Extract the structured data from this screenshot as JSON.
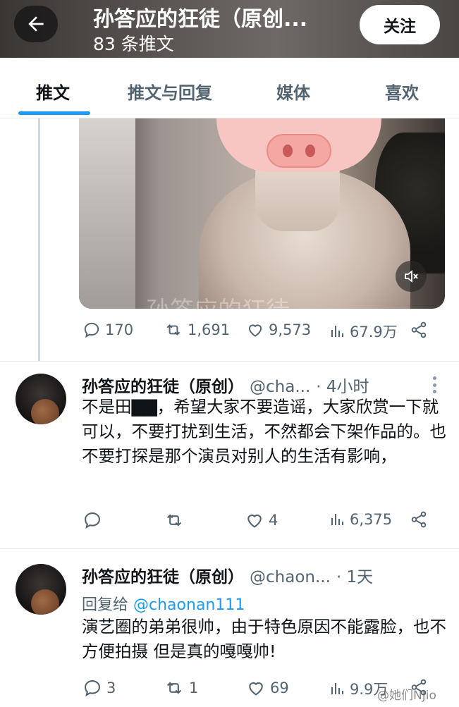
{
  "header": {
    "title": "孙答应的狂徒（原创...",
    "subtitle": "83 条推文",
    "follow_label": "关注",
    "back_icon": "arrow-left-icon"
  },
  "tabs": [
    {
      "label": "推文",
      "active": true
    },
    {
      "label": "推文与回复",
      "active": false
    },
    {
      "label": "媒体",
      "active": false
    },
    {
      "label": "喜欢",
      "active": false
    }
  ],
  "media": {
    "watermark": "孙答应的狂徒",
    "mute_icon": "volume-mute-icon"
  },
  "pinned_stats": {
    "replies": "170",
    "retweets": "1,691",
    "likes": "9,573",
    "views": "67.9万"
  },
  "tweets": [
    {
      "name": "孙答应的狂徒（原创）",
      "handle": "@cha...",
      "time": "· 4小时",
      "text": "不是田▇▇，希望大家不要造谣，大家欣赏一下就可以，不要打扰到生活，不然都会下架作品的。也不要打探是那个演员对别人的生活有影响，",
      "stats": {
        "replies": "",
        "retweets": "",
        "likes": "4",
        "views": "6,375"
      }
    },
    {
      "name": "孙答应的狂徒（原创）",
      "handle": "@chaon...",
      "time": "· 1天",
      "reply_prefix": "回复给",
      "reply_handle": "@chaonan111",
      "text": "演艺圈的弟弟很帅，由于特色原因不能露脸，也不方便拍摄 但是真的嘎嘎帅!",
      "stats": {
        "replies": "3",
        "retweets": "1",
        "likes": "69",
        "views": "9.9万"
      }
    }
  ],
  "watermark": "@她们NJio",
  "colors": {
    "accent": "#1d9bf0",
    "text": "#0f1419",
    "muted": "#536471"
  }
}
